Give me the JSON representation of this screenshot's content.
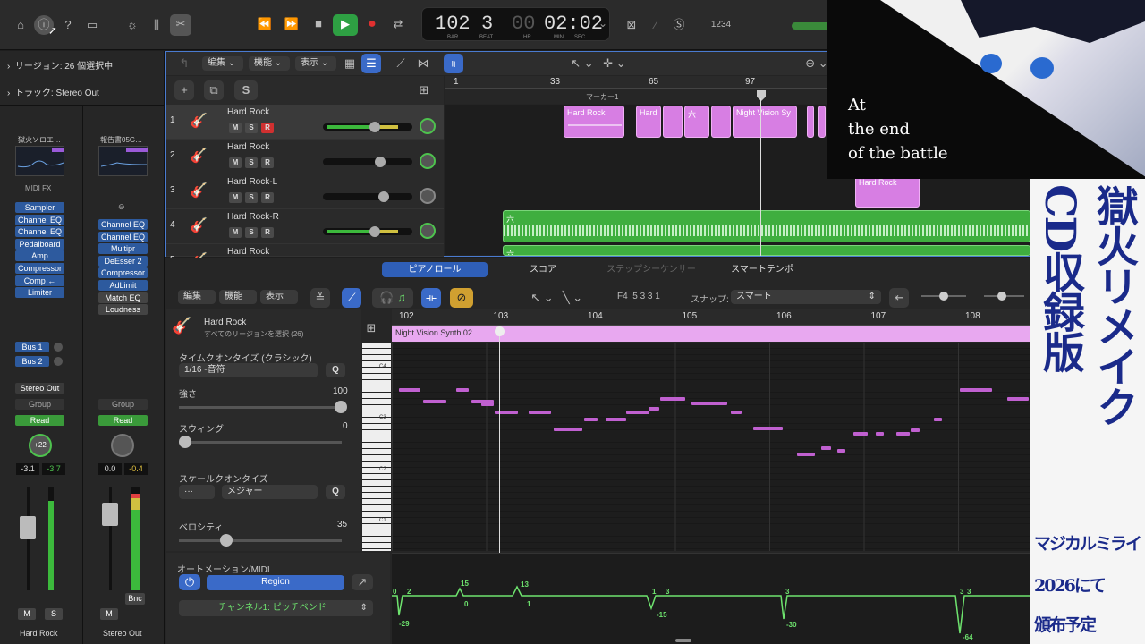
{
  "toolbar": {
    "transport": {
      "rewind": "⏪",
      "ffwd": "⏩",
      "stop": "■",
      "play": "▶",
      "record": "●",
      "cycle": "⇄"
    },
    "lcd": {
      "bar": "102",
      "beat": "3",
      "hr": "00",
      "minsec": "02:02",
      "bar_label": "BAR",
      "beat_label": "BEAT",
      "hr_label": "HR",
      "min_label": "MIN",
      "sec_label": "SEC",
      "chevron": "⌄"
    },
    "count_in": "1234"
  },
  "inspector": {
    "region_label": "リージョン: 26 個選択中",
    "track_label": "トラック: Stereo Out",
    "strip1": {
      "name": "獄火ソロエ…",
      "midi_fx": "MIDI FX",
      "plugins": [
        "Sampler",
        "Channel EQ",
        "Channel EQ",
        "Pedalboard",
        "Amp",
        "Compressor",
        "Comp ←",
        "Limiter"
      ],
      "sends": [
        "Bus 1",
        "Bus 2"
      ],
      "output": "Stereo Out",
      "group": "Group",
      "read": "Read",
      "pan": "+22",
      "vol": "-3.1",
      "peak": "-3.7",
      "mute": "M",
      "solo": "S",
      "label": "Hard Rock"
    },
    "strip2": {
      "name": "報告書05G…",
      "plugins": [
        "Channel EQ",
        "Channel EQ",
        "Multipr",
        "DeEsser 2",
        "Compressor",
        "AdLimit",
        "Match EQ",
        "Loudness"
      ],
      "group": "Group",
      "read": "Read",
      "vol": "0.0",
      "peak": "-0.4",
      "mute": "M",
      "bnc": "Bnc",
      "label": "Stereo Out"
    }
  },
  "tracks_area": {
    "menus": [
      "編集 ⌄",
      "機能 ⌄",
      "表示 ⌄"
    ],
    "ruler": [
      "1",
      "33",
      "65",
      "97"
    ],
    "marker": "マーカー1",
    "tracks": [
      {
        "num": "1",
        "name": "Hard Rock",
        "record": true
      },
      {
        "num": "2",
        "name": "Hard Rock",
        "record": false
      },
      {
        "num": "3",
        "name": "Hard Rock-L",
        "record": false
      },
      {
        "num": "4",
        "name": "Hard Rock-R",
        "record": false
      },
      {
        "num": "5",
        "name": "Hard Rock",
        "record": false
      }
    ],
    "regions": [
      "Hard Rock",
      "Hard",
      "六",
      "Night Vision Sy",
      "Hard Rock",
      "六",
      "六"
    ]
  },
  "editor": {
    "tabs": [
      "ピアノロール",
      "スコア",
      "ステップシーケンサー",
      "スマートテンポ"
    ],
    "active_tab": "ピアノロール",
    "menus": [
      "編集 ⌄",
      "機能 ⌄",
      "表示 ⌄"
    ],
    "position": "F4  5 3 3 1",
    "snap_label": "スナップ:",
    "snap_value": "スマート",
    "track_name": "Hard Rock",
    "track_sub": "すべてのリージョンを選択 (26)",
    "quantize_label": "タイムクオンタイズ (クラシック)",
    "quantize_value": "1/16 -音符",
    "q": "Q",
    "strength_label": "強さ",
    "strength_value": "100",
    "swing_label": "スウィング",
    "swing_value": "0",
    "scale_label": "スケールクオンタイズ",
    "scale_root": "···",
    "scale_value": "メジャー",
    "velocity_label": "ベロシティ",
    "velocity_value": "35",
    "automation_label": "オートメーション/MIDI",
    "region_btn": "Region",
    "channel": "チャンネル1: ピッチベンド",
    "ruler": [
      "102",
      "103",
      "104",
      "105",
      "106",
      "107",
      "108"
    ],
    "region_name": "Night Vision Synth 02",
    "keys": [
      "C4",
      "C3",
      "C2",
      "C1"
    ],
    "pitch_values": [
      "0",
      "2",
      "-29",
      "15",
      "0",
      "13",
      "1",
      "1",
      "3",
      "-15",
      "3",
      "-30",
      "3",
      "3",
      "-64"
    ]
  },
  "overlay": {
    "caption": [
      "At",
      "the end",
      "of the battle"
    ],
    "title_col1": "獄火リメイク",
    "title_col2": "CD収録版",
    "sub_col1": "マジカルミライ",
    "sub_col2": "2026にて",
    "sub_col3": "頒布予定"
  }
}
